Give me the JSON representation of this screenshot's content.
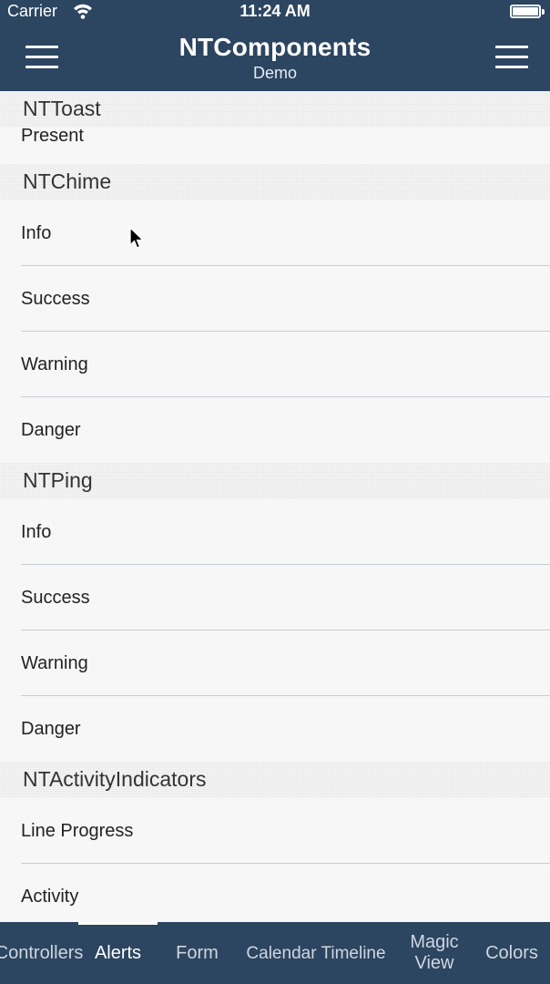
{
  "status_bar": {
    "carrier": "Carrier",
    "time": "11:24 AM"
  },
  "nav": {
    "title": "NTComponents",
    "subtitle": "Demo"
  },
  "sections": [
    {
      "header": "NTToast",
      "items": [
        "Present"
      ]
    },
    {
      "header": "NTChime",
      "items": [
        "Info",
        "Success",
        "Warning",
        "Danger"
      ]
    },
    {
      "header": "NTPing",
      "items": [
        "Info",
        "Success",
        "Warning",
        "Danger"
      ]
    },
    {
      "header": "NTActivityIndicators",
      "items": [
        "Line Progress",
        "Activity"
      ]
    }
  ],
  "tabs": [
    {
      "label": "Controllers"
    },
    {
      "label": "Alerts"
    },
    {
      "label": "Form"
    },
    {
      "label": "Calendar Timeline"
    },
    {
      "label": "Magic View"
    },
    {
      "label": "Colors"
    }
  ],
  "colors": {
    "bar": "#2c4560",
    "background": "#f5f5f5",
    "header": "#e7e7e7"
  },
  "icons": [
    "wifi-icon",
    "battery-icon",
    "menu-icon"
  ]
}
